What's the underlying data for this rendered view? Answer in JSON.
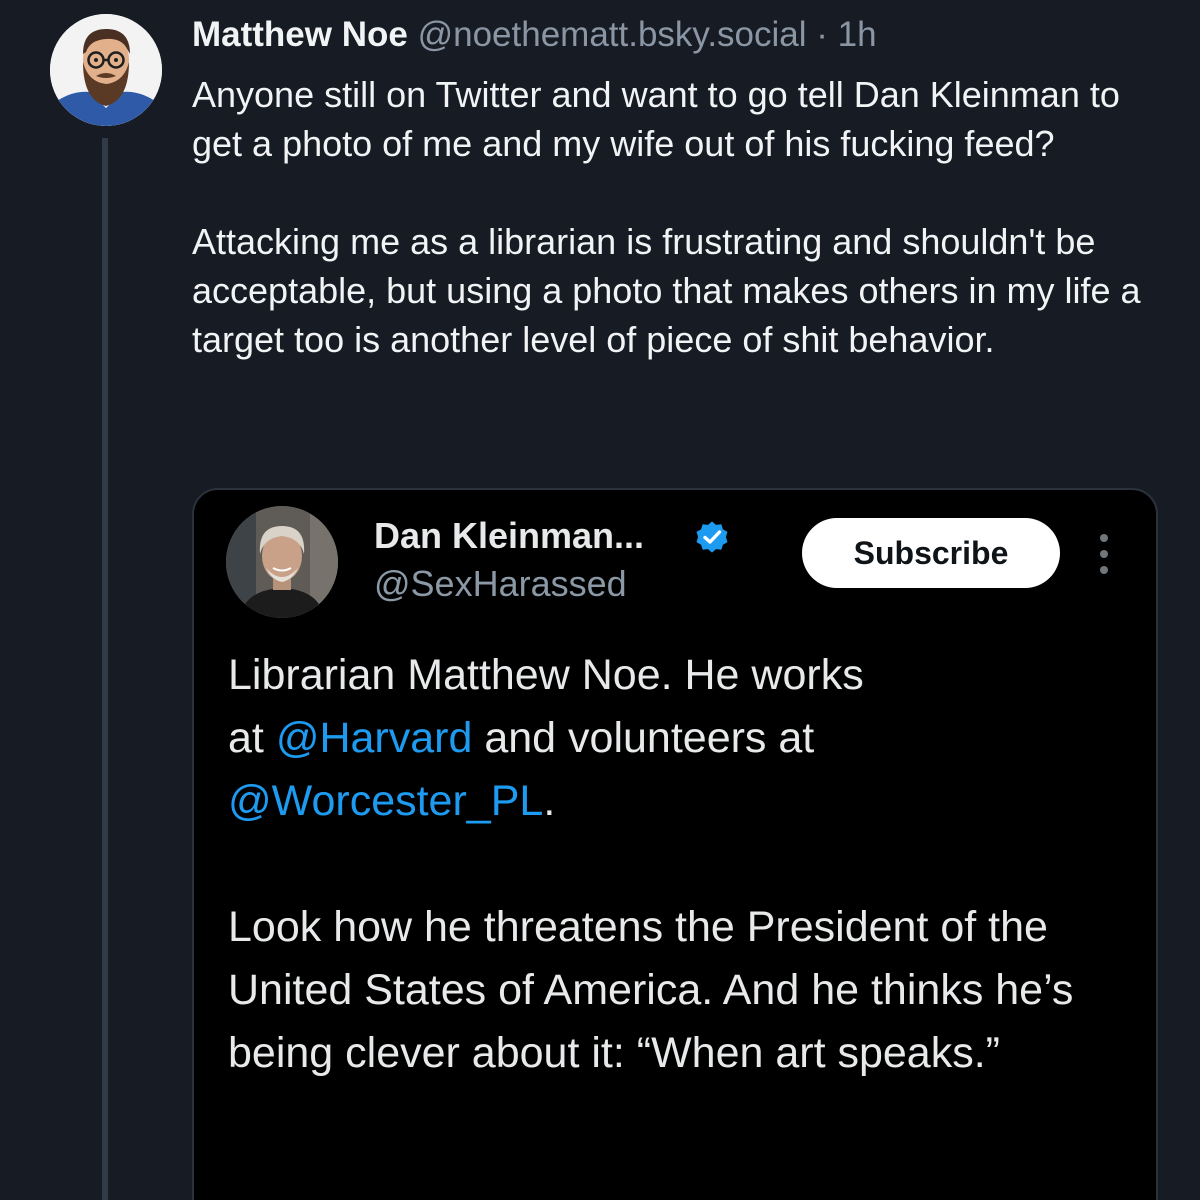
{
  "post": {
    "author_name": "Matthew Noe",
    "author_handle": "@noethematt.bsky.social",
    "separator": "·",
    "timestamp": "1h",
    "paragraph_1": "Anyone still on Twitter and want to go tell Dan Kleinman to get a photo of me and my wife out of his fucking feed?",
    "paragraph_2": "Attacking me as a librarian is frustrating and shouldn't be acceptable,  but using a photo that makes others in my life a target too is another level of piece of shit behavior."
  },
  "embed": {
    "author_name": "Dan Kleinman...",
    "author_handle": "@SexHarassed",
    "subscribe_label": "Subscribe",
    "text": {
      "line_1": "Librarian Matthew Noe. He works",
      "line_2_prefix": "at ",
      "mention_1": "@Harvard",
      "line_2_suffix": " and volunteers at",
      "mention_2": "@Worcester_PL",
      "line_3_suffix": ".",
      "paragraph_2": "Look how he threatens the President of the United States of America. And he thinks he’s being clever about it: “When art speaks.”"
    }
  },
  "icons": {
    "verified": "verified-badge-icon",
    "more": "more-options-icon"
  },
  "colors": {
    "background": "#171c24",
    "embed_background": "#000000",
    "mention": "#1d9bf0",
    "verified_badge": "#1d9bf0",
    "muted_text": "#8b96a5"
  }
}
